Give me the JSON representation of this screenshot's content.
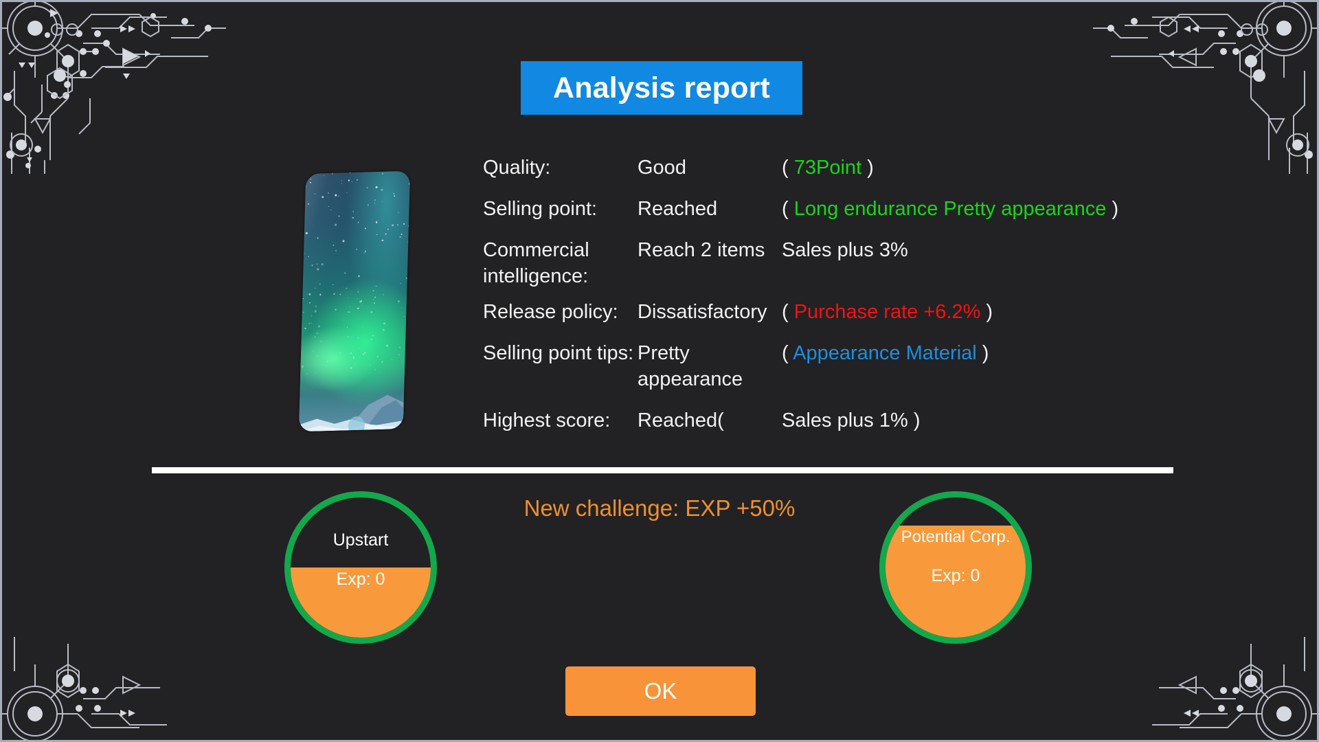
{
  "title": {
    "text": "Analysis report"
  },
  "colors": {
    "banner_blue": "#1189e2",
    "good_green": "#19d619",
    "bad_red": "#f41212",
    "tip_blue": "#1b8fe0",
    "accent_orange": "#f8933a",
    "ring_green": "#13a84c",
    "panel_bg": "#222224"
  },
  "product": {
    "name": "phone-preview",
    "wallpaper": "aurora-borealis"
  },
  "report": {
    "rows": [
      {
        "label": "Quality:",
        "value": "Good",
        "paren_open": "(",
        "extra": "73Point",
        "extra_color": "green",
        "paren_close": ")"
      },
      {
        "label": "Selling point:",
        "value": "Reached",
        "paren_open": "(",
        "extra": "Long endurance  Pretty appearance",
        "extra_color": "green",
        "paren_close": ")"
      },
      {
        "label": "Commercial\nintelligence:",
        "value": "Reach 2 items",
        "paren_open": "",
        "extra": "Sales plus 3%",
        "extra_color": "white",
        "paren_close": ""
      },
      {
        "label": "Release policy:",
        "value": "Dissatisfactory",
        "paren_open": "(",
        "extra": "Purchase rate +6.2%",
        "extra_color": "red",
        "paren_close": ")"
      },
      {
        "label": "Selling point tips:",
        "value": "Pretty appearance",
        "paren_open": "(",
        "extra": "Appearance  Material",
        "extra_color": "blue",
        "paren_close": ")"
      },
      {
        "label": "Highest score:",
        "value": "Reached(",
        "paren_open": "",
        "extra": "Sales plus 1%",
        "extra_color": "white",
        "paren_close": ")"
      }
    ]
  },
  "new_challenge": {
    "text": "New challenge: EXP +50%"
  },
  "exp": {
    "left": {
      "name": "Upstart",
      "exp_label": "Exp: 0",
      "fill_percent": 50
    },
    "right": {
      "name": "Potential Corp.",
      "exp_label": "Exp: 0",
      "fill_percent": 80
    }
  },
  "footer": {
    "ok_label": "OK"
  }
}
